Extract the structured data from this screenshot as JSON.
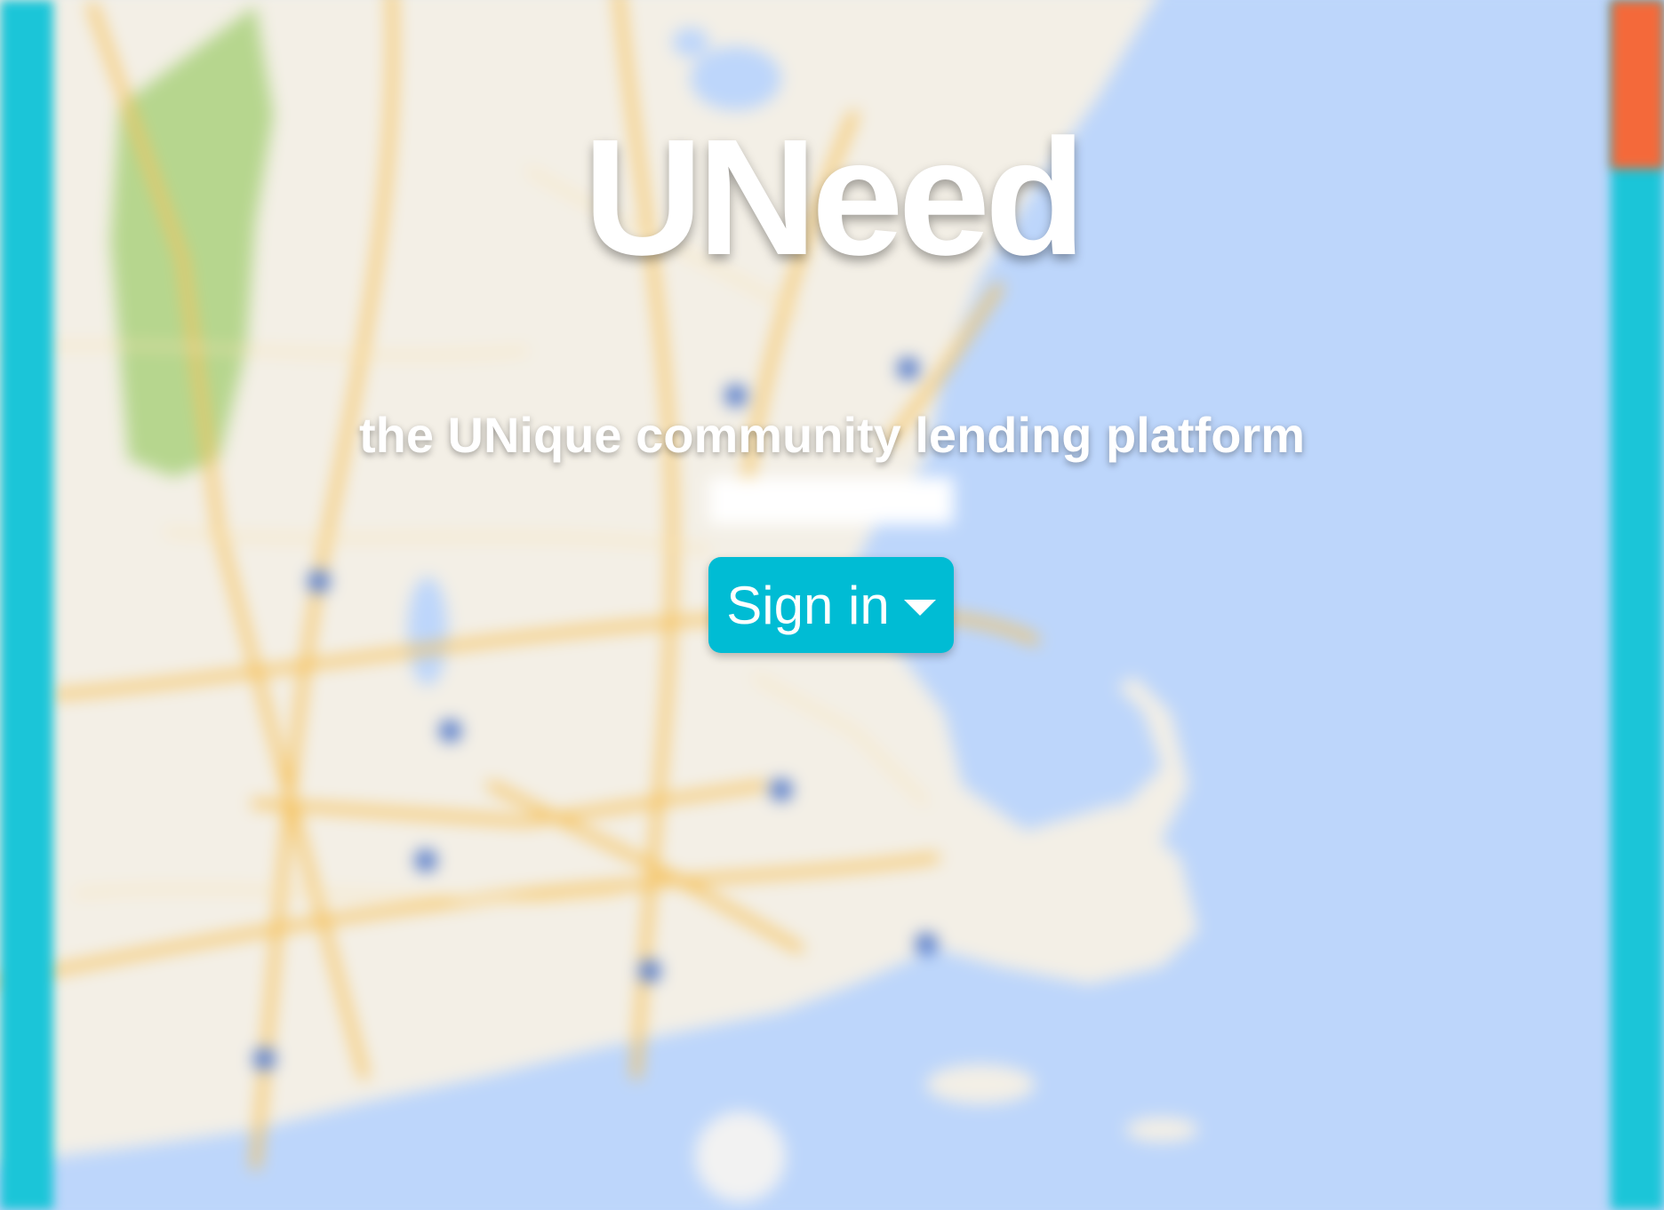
{
  "app": {
    "title": "UNeed",
    "tagline": "the UNique community lending platform"
  },
  "signin": {
    "label": "Sign in",
    "icon": "caret-down-icon"
  },
  "colors": {
    "accent": "#00bcd4",
    "side_bar": "#1bc5d8",
    "side_bar_accent": "#f4693a",
    "water": "#bdd6fb",
    "land": "#f3efe6",
    "road": "#f6c25c",
    "park": "#b6d68e"
  },
  "background": {
    "type": "map",
    "blurred": true
  }
}
